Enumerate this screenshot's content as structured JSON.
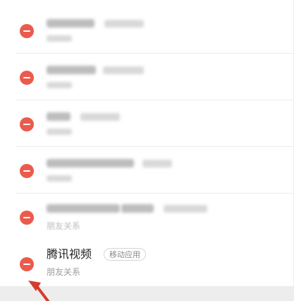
{
  "items": [
    {
      "title": "",
      "badge": "",
      "subtitle": ""
    },
    {
      "title": "",
      "badge": "",
      "subtitle": ""
    },
    {
      "title": "",
      "badge": "",
      "subtitle": ""
    },
    {
      "title": "",
      "badge": "",
      "subtitle": ""
    },
    {
      "title": "",
      "badge": "",
      "subtitle": "朋友关系"
    },
    {
      "title": "腾讯视频",
      "badge": "移动应用",
      "subtitle": "朋友关系"
    }
  ],
  "colors": {
    "remove_button": "#ea5b4d",
    "annotation_arrow": "#d63b2f"
  },
  "icons": {
    "remove": "minus-circle-icon",
    "annotation": "red-arrow-icon"
  }
}
